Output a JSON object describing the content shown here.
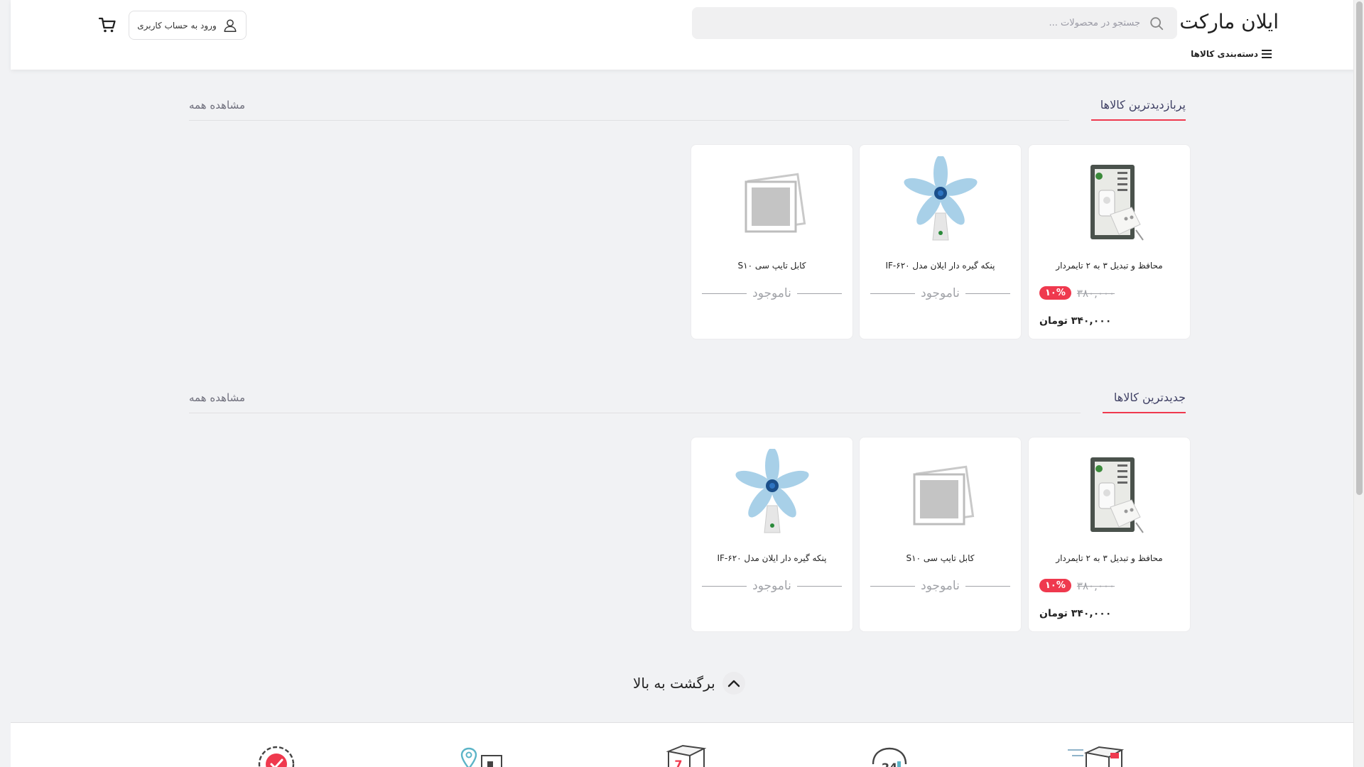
{
  "header": {
    "logo": "ایلان مارکت",
    "search_placeholder": "جستجو در محصولات ...",
    "categories_label": "دسته‌بندی کالاها",
    "login_label": "ورود به حساب کاربری"
  },
  "sections": [
    {
      "title": "پربازدیدترین کالاها",
      "view_all": "مشاهده همه",
      "products": [
        {
          "name": "محافظ و تبدیل ۳ به ۲ تایمردار",
          "discount": "۱۰%",
          "old_price": "۳۸۰,۰۰۰",
          "price": "۳۴۰,۰۰۰ تومان",
          "image": "power-strip"
        },
        {
          "name": "پنکه گیره دار ایلان مدل IF-۶۲۰",
          "status": "ناموجود",
          "image": "fan"
        },
        {
          "name": "کابل تایپ سی S۱۰",
          "status": "ناموجود",
          "image": "placeholder"
        }
      ]
    },
    {
      "title": "جدیدترین کالاها",
      "view_all": "مشاهده همه",
      "products": [
        {
          "name": "محافظ و تبدیل ۳ به ۲ تایمردار",
          "discount": "۱۰%",
          "old_price": "۳۸۰,۰۰۰",
          "price": "۳۴۰,۰۰۰ تومان",
          "image": "power-strip"
        },
        {
          "name": "کابل تایپ سی S۱۰",
          "status": "ناموجود",
          "image": "placeholder"
        },
        {
          "name": "پنکه گیره دار ایلان مدل IF-۶۲۰",
          "status": "ناموجود",
          "image": "fan"
        }
      ]
    }
  ],
  "back_to_top": "برگشت به بالا",
  "footer_icons": [
    "fast-delivery-icon",
    "support-24-icon",
    "return-7-days-icon",
    "store-location-icon",
    "quality-guarantee-icon"
  ],
  "colors": {
    "accent": "#ef394e",
    "text": "#3f4064",
    "background": "#f1f2f4"
  }
}
